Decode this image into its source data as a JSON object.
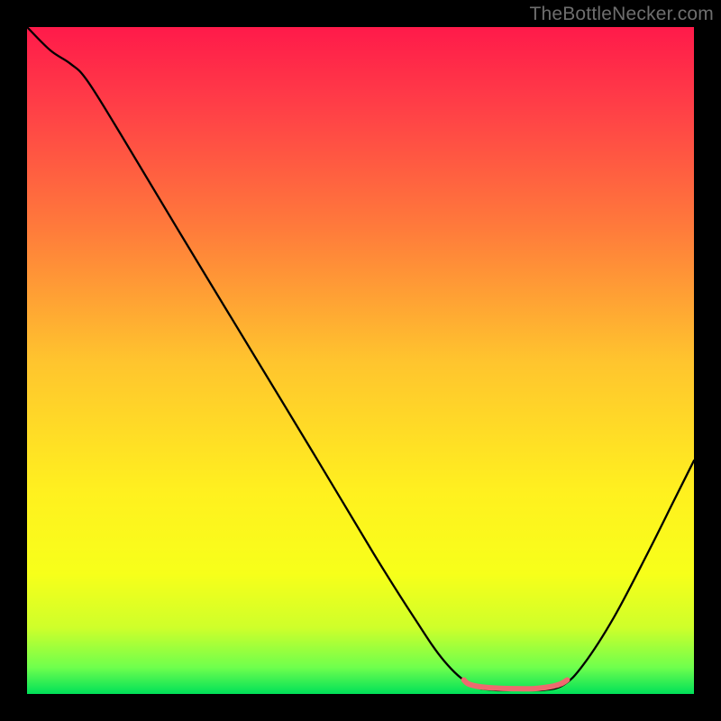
{
  "attribution": "TheBottleNecker.com",
  "chart_data": {
    "type": "line",
    "title": "",
    "xlabel": "",
    "ylabel": "",
    "xlim": [
      0,
      100
    ],
    "ylim": [
      0,
      100
    ],
    "background_gradient": {
      "stops": [
        {
          "offset": 0.0,
          "color": "#ff1a4a"
        },
        {
          "offset": 0.12,
          "color": "#ff3f47"
        },
        {
          "offset": 0.3,
          "color": "#ff7a3b"
        },
        {
          "offset": 0.5,
          "color": "#ffc42e"
        },
        {
          "offset": 0.7,
          "color": "#fff11f"
        },
        {
          "offset": 0.82,
          "color": "#f7ff1a"
        },
        {
          "offset": 0.9,
          "color": "#cfff2a"
        },
        {
          "offset": 0.96,
          "color": "#6fff4d"
        },
        {
          "offset": 1.0,
          "color": "#00e059"
        }
      ]
    },
    "series": [
      {
        "name": "bottleneck-curve",
        "color": "#000000",
        "width": 2.3,
        "points": [
          {
            "x": 0.0,
            "y": 100.0
          },
          {
            "x": 3.5,
            "y": 96.5
          },
          {
            "x": 6.5,
            "y": 94.5
          },
          {
            "x": 9.0,
            "y": 92.0
          },
          {
            "x": 14.0,
            "y": 84.0
          },
          {
            "x": 23.0,
            "y": 69.0
          },
          {
            "x": 33.0,
            "y": 52.5
          },
          {
            "x": 43.0,
            "y": 36.0
          },
          {
            "x": 52.0,
            "y": 21.0
          },
          {
            "x": 58.0,
            "y": 11.5
          },
          {
            "x": 62.5,
            "y": 5.0
          },
          {
            "x": 66.5,
            "y": 1.4
          },
          {
            "x": 70.0,
            "y": 0.6
          },
          {
            "x": 74.0,
            "y": 0.6
          },
          {
            "x": 77.5,
            "y": 0.6
          },
          {
            "x": 80.5,
            "y": 1.4
          },
          {
            "x": 83.5,
            "y": 4.5
          },
          {
            "x": 88.0,
            "y": 11.5
          },
          {
            "x": 93.0,
            "y": 21.0
          },
          {
            "x": 97.0,
            "y": 29.0
          },
          {
            "x": 100.0,
            "y": 35.0
          }
        ]
      },
      {
        "name": "sweet-spot-overlay",
        "color": "#ee6a6f",
        "width": 6.0,
        "points": [
          {
            "x": 65.5,
            "y": 2.1
          },
          {
            "x": 66.2,
            "y": 1.5
          },
          {
            "x": 67.8,
            "y": 1.1
          },
          {
            "x": 70.0,
            "y": 0.9
          },
          {
            "x": 73.0,
            "y": 0.8
          },
          {
            "x": 76.0,
            "y": 0.8
          },
          {
            "x": 78.5,
            "y": 1.1
          },
          {
            "x": 80.0,
            "y": 1.5
          },
          {
            "x": 81.0,
            "y": 2.1
          }
        ]
      }
    ]
  }
}
